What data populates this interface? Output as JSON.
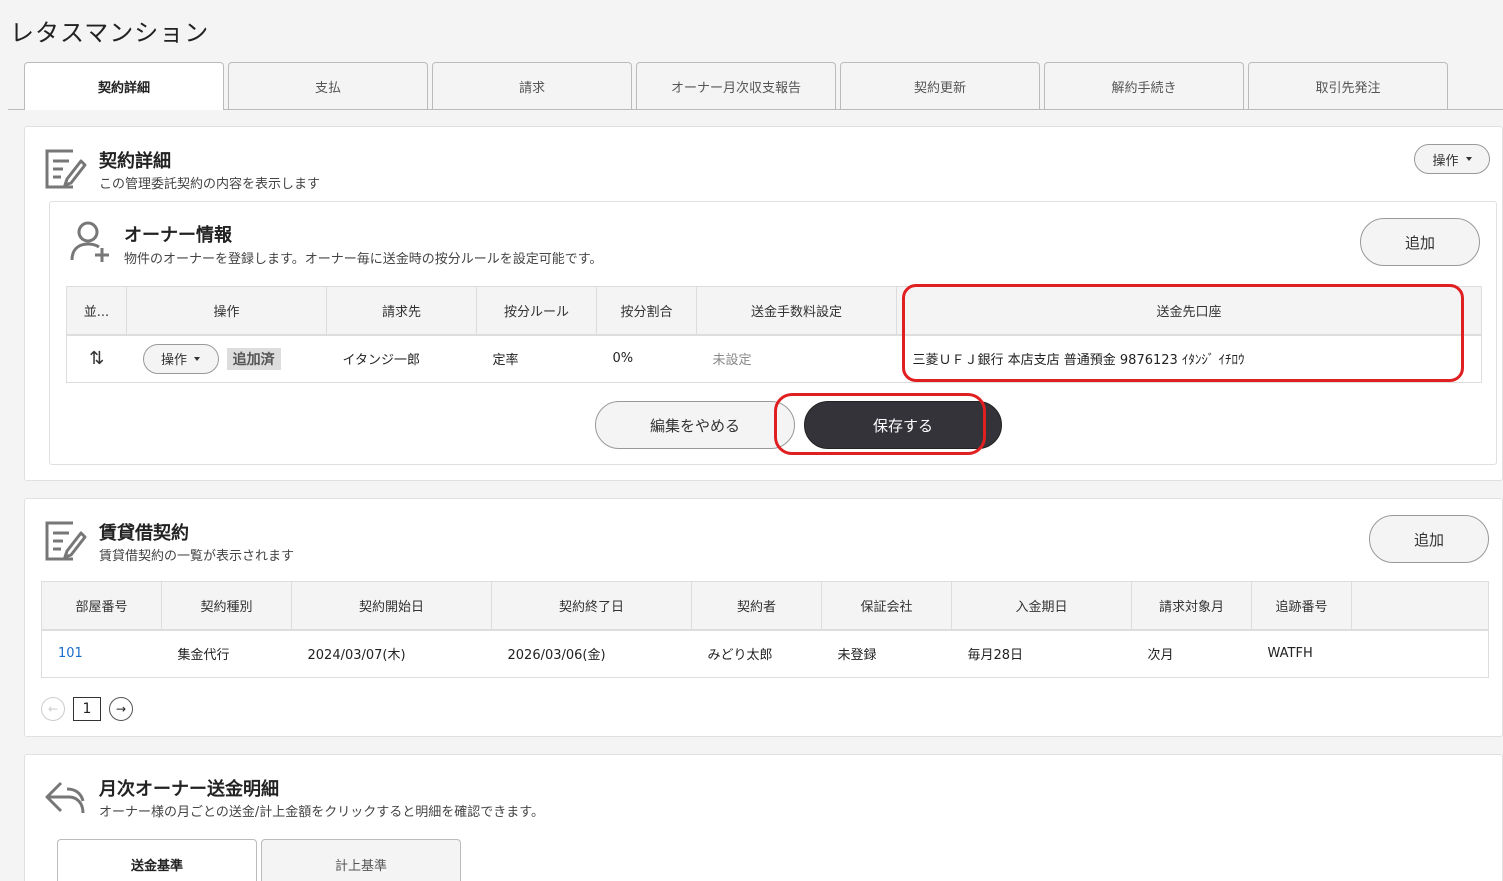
{
  "app_title": "レタスマンション",
  "tabs": [
    "契約詳細",
    "支払",
    "請求",
    "オーナー月次収支報告",
    "契約更新",
    "解約手続き",
    "取引先発注"
  ],
  "contract_section": {
    "title": "契約詳細",
    "desc": "この管理委託契約の内容を表示します",
    "action_label": "操作"
  },
  "owner_section": {
    "title": "オーナー情報",
    "desc": "物件のオーナーを登録します。オーナー毎に送金時の按分ルールを設定可能です。",
    "add_label": "追加",
    "headers": [
      "並...",
      "操作",
      "請求先",
      "按分ルール",
      "按分割合",
      "送金手数料設定",
      "送金先口座"
    ],
    "row": {
      "sort_glyph": "⇅",
      "action_label": "操作",
      "added_badge": "追加済",
      "billing_to": "イタンジ一郎",
      "rule": "定率",
      "ratio": "0%",
      "fee_setting": "未設定",
      "account": "三菱ＵＦＪ銀行 本店支店 普通預金 9876123 ｲﾀﾝｼﾞ ｲﾁﾛｳ"
    },
    "cancel_label": "編集をやめる",
    "save_label": "保存する"
  },
  "lease_section": {
    "title": "賃貸借契約",
    "desc": "賃貸借契約の一覧が表示されます",
    "add_label": "追加",
    "headers": [
      "部屋番号",
      "契約種別",
      "契約開始日",
      "契約終了日",
      "契約者",
      "保証会社",
      "入金期日",
      "請求対象月",
      "追跡番号"
    ],
    "rows": [
      {
        "room": "101",
        "type": "集金代行",
        "start": "2024/03/07(木)",
        "end": "2026/03/06(金)",
        "contractor": "みどり太郎",
        "guarantor": "未登録",
        "due": "毎月28日",
        "target_month": "次月",
        "tracking": "WATFH"
      }
    ],
    "pager": {
      "prev": "←",
      "page": "1",
      "next": "→"
    }
  },
  "monthly_section": {
    "title": "月次オーナー送金明細",
    "desc": "オーナー様の月ごとの送金/計上金額をクリックすると明細を確認できます。",
    "subtabs": [
      "送金基準",
      "計上基準"
    ]
  },
  "colors": {
    "highlight": "#e02020",
    "save_bg": "#35333a",
    "link": "#1a6dcc"
  },
  "icons": [
    "edit-document-icon",
    "user-add-icon",
    "reply-arrow-icon",
    "caret-down-icon",
    "sort-arrows-icon"
  ]
}
